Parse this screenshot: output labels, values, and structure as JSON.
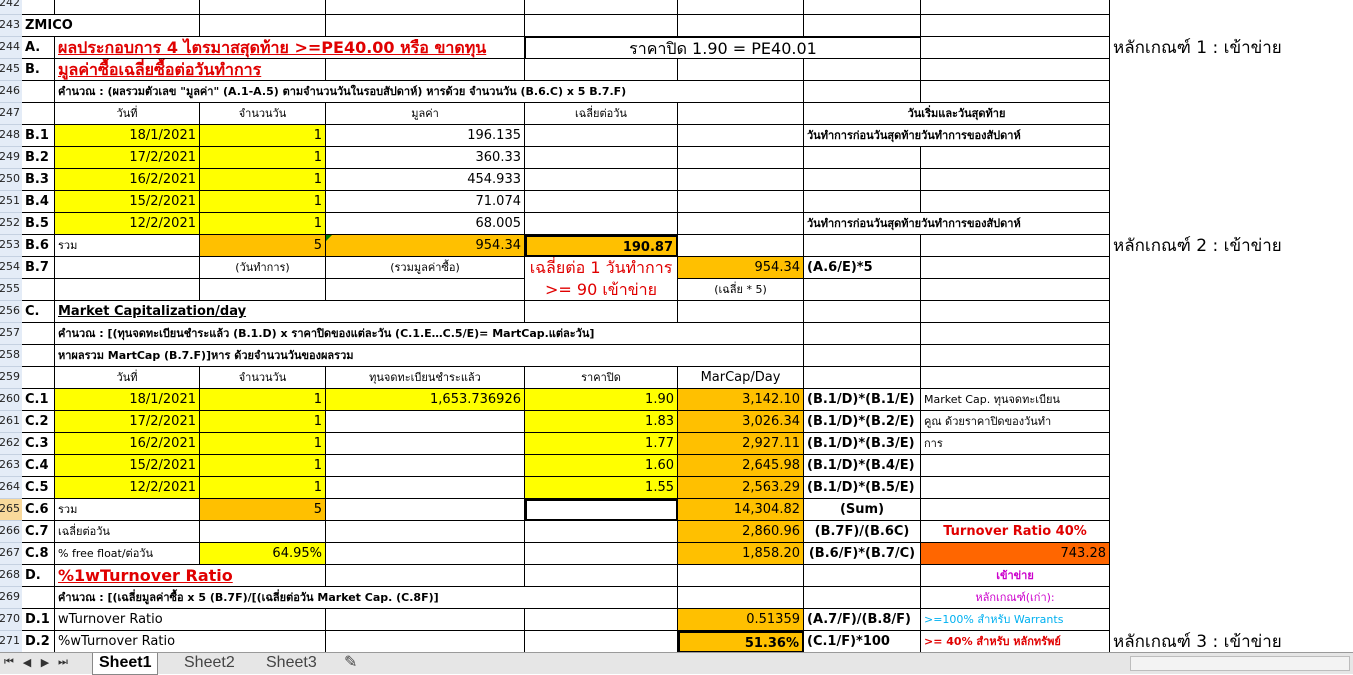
{
  "rows": [
    "242",
    "243",
    "244",
    "245",
    "246",
    "247",
    "248",
    "249",
    "250",
    "251",
    "252",
    "253",
    "254",
    "255",
    "256",
    "257",
    "258",
    "259",
    "260",
    "261",
    "262",
    "263",
    "264",
    "265",
    "266",
    "267",
    "268",
    "269",
    "270",
    "271"
  ],
  "r243": {
    "a": "ZMICO"
  },
  "r244": {
    "a": "A.",
    "b": "ผลประกอบการ 4 ไตรมาสสุดท้าย >=PE40.00 หรือ ขาดทุน",
    "e": "ราคาปิด 1.90 = PE40.01",
    "note": "หลักเกณฑ์ 1 : เข้าข่าย"
  },
  "r245": {
    "a": "B.",
    "b": "มูลค่าซื้อเฉลี่ยซื้อต่อวันทำการ"
  },
  "r246": {
    "b": "คำนวณ : (ผลรวมตัวเลข \"มูลค่า\" (A.1-A.5) ตามจำนวนวันในรอบสัปดาห์) หารด้วย จำนวนวัน (B.6.C) x 5 B.7.F)"
  },
  "r247": {
    "b": "วันที่",
    "c": "จำนวนวัน",
    "d": "มูลค่า",
    "e": "เฉลี่ยต่อวัน",
    "h": "วันเริ่มและวันสุดท้าย"
  },
  "bRows": [
    {
      "a": "B.1",
      "date": "18/1/2021",
      "days": "1",
      "value": "196.135"
    },
    {
      "a": "B.2",
      "date": "17/2/2021",
      "days": "1",
      "value": "360.33"
    },
    {
      "a": "B.3",
      "date": "16/2/2021",
      "days": "1",
      "value": "454.933"
    },
    {
      "a": "B.4",
      "date": "15/2/2021",
      "days": "1",
      "value": "71.074"
    },
    {
      "a": "B.5",
      "date": "12/2/2021",
      "days": "1",
      "value": "68.005"
    }
  ],
  "r248": {
    "h": "วันทำการก่อนวันสุดท้ายวันทำการของสัปดาห์"
  },
  "r252": {
    "h": "วันทำการก่อนวันสุดท้ายวันทำการของสัปดาห์"
  },
  "r253": {
    "a": "B.6",
    "b": "รวม",
    "c": "5",
    "d": "954.34",
    "e": "190.87",
    "note": "หลักเกณฑ์ 2 : เข้าข่าย"
  },
  "r254": {
    "a": "B.7",
    "c": "(วันทำการ)",
    "d": "(รวมมูลค่าซื้อ)",
    "e": "เฉลี่ยต่อ 1 วันทำการ",
    "g": "954.34",
    "h": "(A.6/E)*5"
  },
  "r255": {
    "e": ">= 90 เข้าข่าย",
    "g": "(เฉลี่ย * 5)"
  },
  "r256": {
    "a": "C.",
    "b": "Market Capitalization/day"
  },
  "r257": {
    "b": "คำนวณ :  [(ทุนจดทะเบียนชำระแล้ว (B.1.D) x ราคาปิดของแต่ละวัน (C.1.E…C.5/E)= MartCap.แต่ละวัน]"
  },
  "r258": {
    "b": "หาผลรวม MartCap (B.7.F)]หาร ด้วยจำนวนวันของผลรวม"
  },
  "r259": {
    "b": "วันที่",
    "c": "จำนวนวัน",
    "d": "ทุนจดทะเบียนชำระแล้ว",
    "e": "ราคาปิด",
    "g": "MarCap/Day"
  },
  "cRows": [
    {
      "a": "C.1",
      "date": "18/1/2021",
      "days": "1",
      "cap": "1,653.736926",
      "price": "1.90",
      "mc": "3,142.10",
      "f": "(B.1/D)*(B.1/E)",
      "i": "Market Cap. ทุนจดทะเบียน"
    },
    {
      "a": "C.2",
      "date": "17/2/2021",
      "days": "1",
      "cap": "",
      "price": "1.83",
      "mc": "3,026.34",
      "f": "(B.1/D)*(B.2/E)",
      "i": "คูณ ด้วยราคาปิดของวันทำ"
    },
    {
      "a": "C.3",
      "date": "16/2/2021",
      "days": "1",
      "cap": "",
      "price": "1.77",
      "mc": "2,927.11",
      "f": "(B.1/D)*(B.3/E)",
      "i": "การ"
    },
    {
      "a": "C.4",
      "date": "15/2/2021",
      "days": "1",
      "cap": "",
      "price": "1.60",
      "mc": "2,645.98",
      "f": "(B.1/D)*(B.4/E)",
      "i": ""
    },
    {
      "a": "C.5",
      "date": "12/2/2021",
      "days": "1",
      "cap": "",
      "price": "1.55",
      "mc": "2,563.29",
      "f": "(B.1/D)*(B.5/E)",
      "i": ""
    }
  ],
  "r265": {
    "a": "C.6",
    "b": "รวม",
    "c": "5",
    "g": "14,304.82",
    "h": "(Sum)"
  },
  "r266": {
    "a": "C.7",
    "b": "เฉลี่ยต่อวัน",
    "g": "2,860.96",
    "h": "(B.7F)/(B.6C)",
    "i": "Turnover Ratio 40%"
  },
  "r267": {
    "a": "C.8",
    "b": "% free float/ต่อวัน",
    "c": "64.95%",
    "g": "1,858.20",
    "h": "(B.6/F)*(B.7/C)",
    "i": "743.28"
  },
  "r268": {
    "a": "D.",
    "b": "%1wTurnover Ratio",
    "i": "เข้าข่าย"
  },
  "r269": {
    "b": "คำนวณ :  [(เฉลี่ยมูลค่าซื้อ x 5  (B.7F)/[(เฉลี่ยต่อวัน Market Cap. (C.8F)]",
    "i": "หลักเกณฑ์(เก่า):"
  },
  "r270": {
    "a": "D.1",
    "b": "wTurnover Ratio",
    "g": "0.51359",
    "h": "(A.7/F)/(B.8/F)",
    "i": ">=100% สำหรับ Warrants"
  },
  "r271": {
    "a": "D.2",
    "b": " %wTurnover Ratio",
    "g": "51.36%",
    "h": "(C.1/F)*100",
    "i": ">= 40% สำหรับ หลักทรัพย์",
    "note": "หลักเกณฑ์ 3 : เข้าข่าย"
  },
  "tabs": [
    "Sheet1",
    "Sheet2",
    "Sheet3"
  ],
  "colors": {
    "yellow": "#ffff00",
    "orange": "#ffc000",
    "darkOrange": "#ff6600",
    "red": "#e00000",
    "magenta": "#cc00cc",
    "cyan": "#00b0f0"
  }
}
